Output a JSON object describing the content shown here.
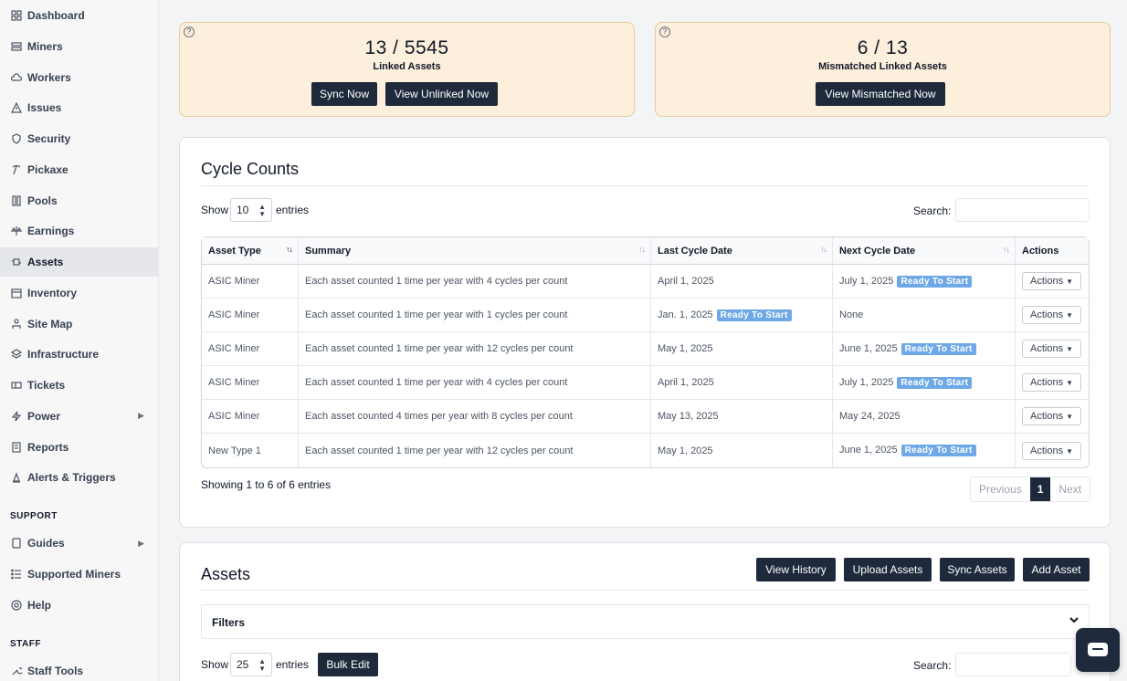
{
  "sidebar": {
    "items": [
      {
        "label": "Dashboard",
        "icon": "grid-icon"
      },
      {
        "label": "Miners",
        "icon": "server-icon"
      },
      {
        "label": "Workers",
        "icon": "cloud-icon"
      },
      {
        "label": "Issues",
        "icon": "warning-icon"
      },
      {
        "label": "Security",
        "icon": "shield-icon"
      },
      {
        "label": "Pickaxe",
        "icon": "pickaxe-icon"
      },
      {
        "label": "Pools",
        "icon": "pools-icon"
      },
      {
        "label": "Earnings",
        "icon": "scale-icon"
      },
      {
        "label": "Assets",
        "icon": "chip-icon"
      },
      {
        "label": "Inventory",
        "icon": "inventory-icon"
      },
      {
        "label": "Site Map",
        "icon": "sitemap-icon"
      },
      {
        "label": "Infrastructure",
        "icon": "layers-icon"
      },
      {
        "label": "Tickets",
        "icon": "ticket-icon"
      },
      {
        "label": "Power",
        "icon": "bolt-icon"
      },
      {
        "label": "Reports",
        "icon": "report-icon"
      },
      {
        "label": "Alerts & Triggers",
        "icon": "alarm-icon"
      }
    ],
    "support_label": "SUPPORT",
    "support_items": [
      {
        "label": "Guides",
        "icon": "book-icon"
      },
      {
        "label": "Supported Miners",
        "icon": "list-icon"
      },
      {
        "label": "Help",
        "icon": "lifebuoy-icon"
      }
    ],
    "staff_label": "STAFF",
    "staff_items": [
      {
        "label": "Staff Tools",
        "icon": "wrench-icon"
      }
    ]
  },
  "linked_card": {
    "count": "13 / 5545",
    "label": "Linked Assets",
    "sync_button": "Sync Now",
    "view_unlinked_button": "View Unlinked Now"
  },
  "mismatched_card": {
    "count": "6 / 13",
    "label": "Mismatched Linked Assets",
    "view_button": "View Mismatched Now"
  },
  "help_glyph": "?",
  "cycle_counts": {
    "title": "Cycle Counts",
    "show_label": "Show",
    "entries_label": "entries",
    "page_size": "10",
    "search_label": "Search:",
    "columns": [
      "Asset Type",
      "Summary",
      "Last Cycle Date",
      "Next Cycle Date",
      "Actions"
    ],
    "rows": [
      {
        "asset_type": "ASIC Miner",
        "summary": "Each asset counted 1 time per year with 4 cycles per count",
        "last": "April 1, 2025",
        "last_badge": "",
        "next": "July 1, 2025",
        "next_badge": "Ready To Start",
        "action": "Actions"
      },
      {
        "asset_type": "ASIC Miner",
        "summary": "Each asset counted 1 time per year with 1 cycles per count",
        "last": "Jan. 1, 2025",
        "last_badge": "Ready To Start",
        "next": "None",
        "next_badge": "",
        "action": "Actions"
      },
      {
        "asset_type": "ASIC Miner",
        "summary": "Each asset counted 1 time per year with 12 cycles per count",
        "last": "May 1, 2025",
        "last_badge": "",
        "next": "June 1, 2025",
        "next_badge": "Ready To Start",
        "action": "Actions"
      },
      {
        "asset_type": "ASIC Miner",
        "summary": "Each asset counted 1 time per year with 4 cycles per count",
        "last": "April 1, 2025",
        "last_badge": "",
        "next": "July 1, 2025",
        "next_badge": "Ready To Start",
        "action": "Actions"
      },
      {
        "asset_type": "ASIC Miner",
        "summary": "Each asset counted 4 times per year with 8 cycles per count",
        "last": "May 13, 2025",
        "last_badge": "",
        "next": "May 24, 2025",
        "next_badge": "",
        "action": "Actions"
      },
      {
        "asset_type": "New Type 1",
        "summary": "Each asset counted 1 time per year with 12 cycles per count",
        "last": "May 1, 2025",
        "last_badge": "",
        "next": "June 1, 2025",
        "next_badge": "Ready To Start",
        "action": "Actions"
      }
    ],
    "info": "Showing 1 to 6 of 6 entries",
    "pager": {
      "previous": "Previous",
      "current": "1",
      "next": "Next"
    }
  },
  "assets": {
    "title": "Assets",
    "buttons": {
      "history": "View History",
      "upload": "Upload Assets",
      "sync": "Sync Assets",
      "add": "Add Asset"
    },
    "filters_label": "Filters",
    "show_label": "Show",
    "page_size": "25",
    "entries_label": "entries",
    "bulk_edit": "Bulk Edit",
    "search_label": "Search:"
  },
  "colors": {
    "accent_dark": "#1e2a3b",
    "card_bg": "#fcefdc",
    "badge": "#6ea8e6"
  }
}
